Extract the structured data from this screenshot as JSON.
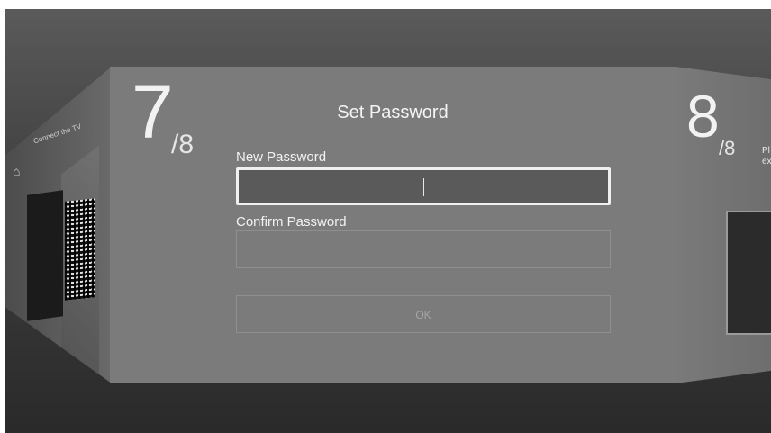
{
  "prev_panel": {
    "title": "Connect the TV"
  },
  "current_panel": {
    "step": "7",
    "total": "/8",
    "title": "Set Password",
    "new_password_label": "New Password",
    "new_password_value": "",
    "confirm_password_label": "Confirm Password",
    "confirm_password_value": "",
    "ok_label": "OK"
  },
  "next_panel": {
    "step": "8",
    "total": "/8",
    "hint": "Pl ex"
  },
  "colors": {
    "background": "#3e3e3e",
    "panel": "#7b7b7b",
    "focus_border": "#f0f0f0"
  }
}
